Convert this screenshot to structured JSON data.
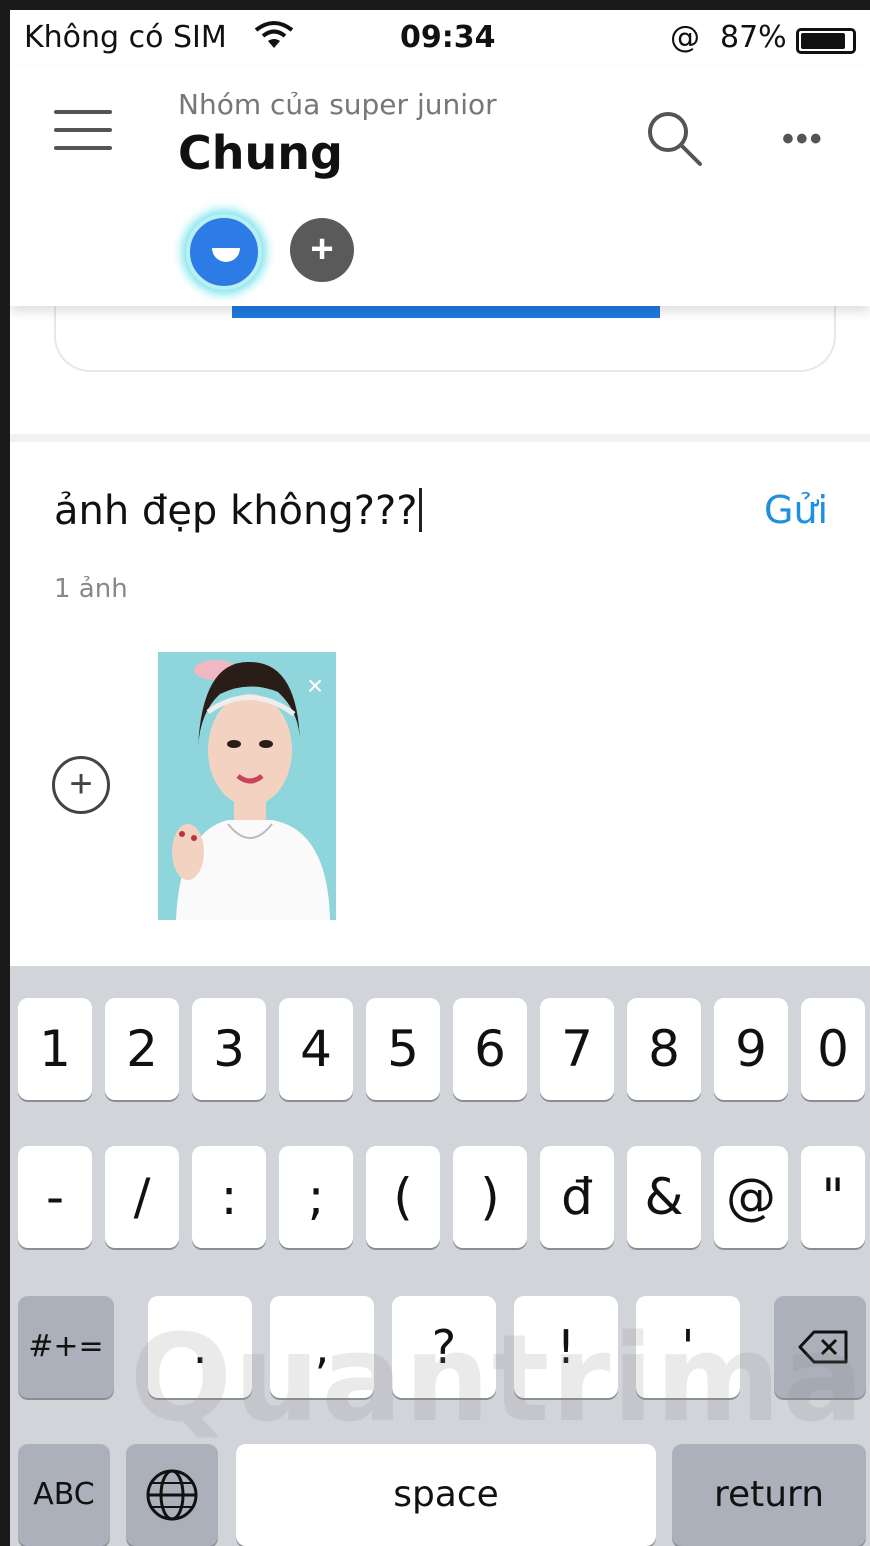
{
  "status_bar": {
    "carrier": "Không có SIM",
    "time": "09:34",
    "alarm": "@",
    "battery": "87%"
  },
  "header": {
    "group_name": "Nhóm của super junior",
    "channel_name": "Chung",
    "more": "•••",
    "add_member": "+"
  },
  "compose": {
    "message": "ảnh đẹp không???",
    "send_label": "Gửi",
    "photo_count": "1 ảnh",
    "add_photo": "+",
    "remove_photo": "×"
  },
  "keyboard": {
    "row1": [
      "1",
      "2",
      "3",
      "4",
      "5",
      "6",
      "7",
      "8",
      "9",
      "0"
    ],
    "row2": [
      "-",
      "/",
      ":",
      ";",
      "(",
      ")",
      "đ",
      "&",
      "@",
      "\""
    ],
    "row3_toggle": "#+=",
    "row3": [
      ".",
      ",",
      "?",
      "!",
      "'"
    ],
    "abc": "ABC",
    "space": "space",
    "return": "return"
  },
  "watermark": "Quantrimang",
  "colors": {
    "accent": "#1f8fe0",
    "avatar": "#2d7be5",
    "keyboard_bg": "#d1d4d9"
  }
}
